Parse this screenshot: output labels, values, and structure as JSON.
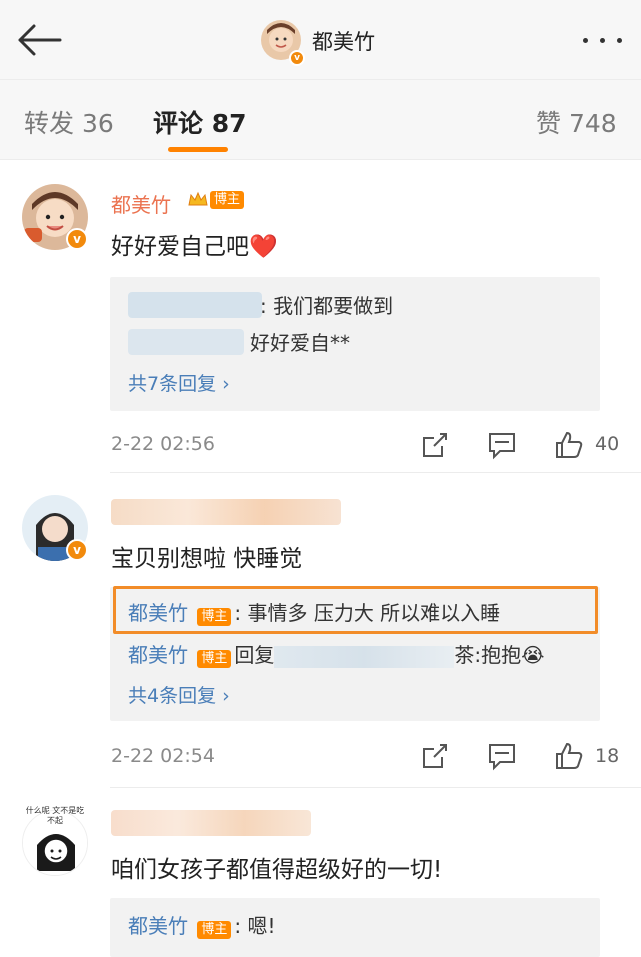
{
  "topbar": {
    "title": "都美竹",
    "back_icon": "back-arrow-icon",
    "more_icon": "more-dots-icon"
  },
  "tabs": [
    {
      "label": "转发 36"
    },
    {
      "label": "评论 87"
    },
    {
      "label": "赞 748"
    }
  ],
  "colors": {
    "accent": "#ff8200",
    "username": "#eb7350",
    "link": "#4a7eb8",
    "highlight": "#f28c28"
  },
  "comments": [
    {
      "username": "都美竹",
      "host_tag": "博主",
      "text": "好好爱自己吧❤️",
      "replies": [
        {
          "text": ": 我们都要做到"
        },
        {
          "text": "好好爱自**"
        }
      ],
      "more_replies": "共7条回复 ",
      "time": "2-22 02:56",
      "likes": "40"
    },
    {
      "text": "宝贝别想啦 快睡觉",
      "replies": [
        {
          "name": "都美竹",
          "tag": "博主",
          "text": ": 事情多 压力大 所以难以入睡"
        },
        {
          "name": "都美竹",
          "tag": "博主",
          "prefix": "回复",
          "suffix": "茶:抱抱😭"
        }
      ],
      "more_replies": "共4条回复 ",
      "time": "2-22 02:54",
      "likes": "18"
    },
    {
      "avatar_text": "什么呢 文不是吃不起",
      "text": "咱们女孩子都值得超级好的一切!",
      "replies": [
        {
          "name": "都美竹",
          "tag": "博主",
          "text": ": 嗯!"
        }
      ]
    }
  ]
}
